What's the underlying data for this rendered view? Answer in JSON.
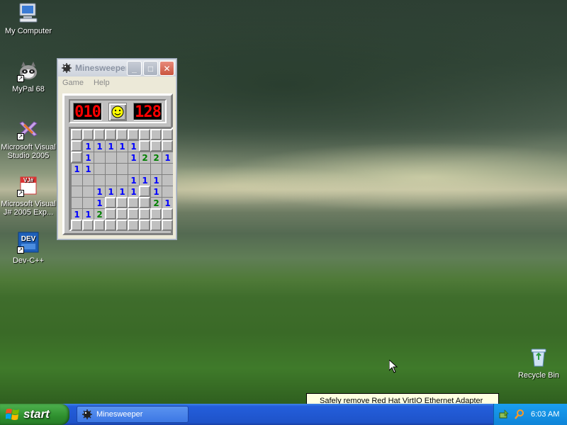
{
  "desktop": {
    "icons": [
      {
        "label": "My Computer",
        "icon": "computer-icon"
      },
      {
        "label": "MyPal 68",
        "icon": "raccoon-browser-icon"
      },
      {
        "label": "Microsoft Visual Studio 2005",
        "label_line1": "Microsoft Visual",
        "label_line2": "Studio 2005",
        "icon": "visual-studio-icon"
      },
      {
        "label": "Microsoft Visual J# 2005 Exp...",
        "label_line1": "Microsoft Visual",
        "label_line2": "J# 2005 Exp...",
        "icon": "vj-sharp-icon"
      },
      {
        "label": "Dev-C++",
        "icon": "dev-cpp-icon"
      },
      {
        "label": "Recycle Bin",
        "icon": "recycle-bin-icon"
      }
    ]
  },
  "minesweeper": {
    "title": "Minesweeper",
    "title_truncated": "Minesweeper",
    "menu": [
      "Game",
      "Help"
    ],
    "mines_counter": "010",
    "timer": "128",
    "face": "smiley",
    "grid": [
      [
        "c",
        "c",
        "c",
        "c",
        "c",
        "c",
        "c",
        "c",
        "c"
      ],
      [
        "c",
        "1",
        "1",
        "1",
        "1",
        "1",
        "c",
        "c",
        "c"
      ],
      [
        "c",
        "1",
        "",
        "",
        "",
        "1",
        "2",
        "2",
        "1"
      ],
      [
        "1",
        "1",
        "",
        "",
        "",
        "",
        "",
        "",
        ""
      ],
      [
        "",
        "",
        "",
        "",
        "",
        "1",
        "1",
        "1",
        ""
      ],
      [
        "",
        "",
        "1",
        "1",
        "1",
        "1",
        "c",
        "1",
        ""
      ],
      [
        "",
        "",
        "1",
        "c",
        "c",
        "c",
        "c",
        "2",
        "1"
      ],
      [
        "1",
        "1",
        "2",
        "c",
        "c",
        "c",
        "c",
        "c",
        "c"
      ],
      [
        "c",
        "c",
        "c",
        "c",
        "c",
        "c",
        "c",
        "c",
        "c"
      ]
    ]
  },
  "taskbar": {
    "start_label": "start",
    "tasks": [
      {
        "label": "Minesweeper",
        "icon": "minesweeper-icon"
      }
    ],
    "tray_icons": [
      "safely-remove-hardware-icon",
      "search-icon"
    ],
    "clock": "6:03 AM"
  },
  "balloon": {
    "text": "Safely remove Red Hat VirtIO Ethernet Adapter"
  },
  "colors": {
    "taskbar_blue": "#245edb",
    "start_green": "#2e8f2e",
    "tray_blue": "#0f84d8",
    "led_red": "#ff0000",
    "number_1": "#0000ff",
    "number_2": "#008000"
  }
}
